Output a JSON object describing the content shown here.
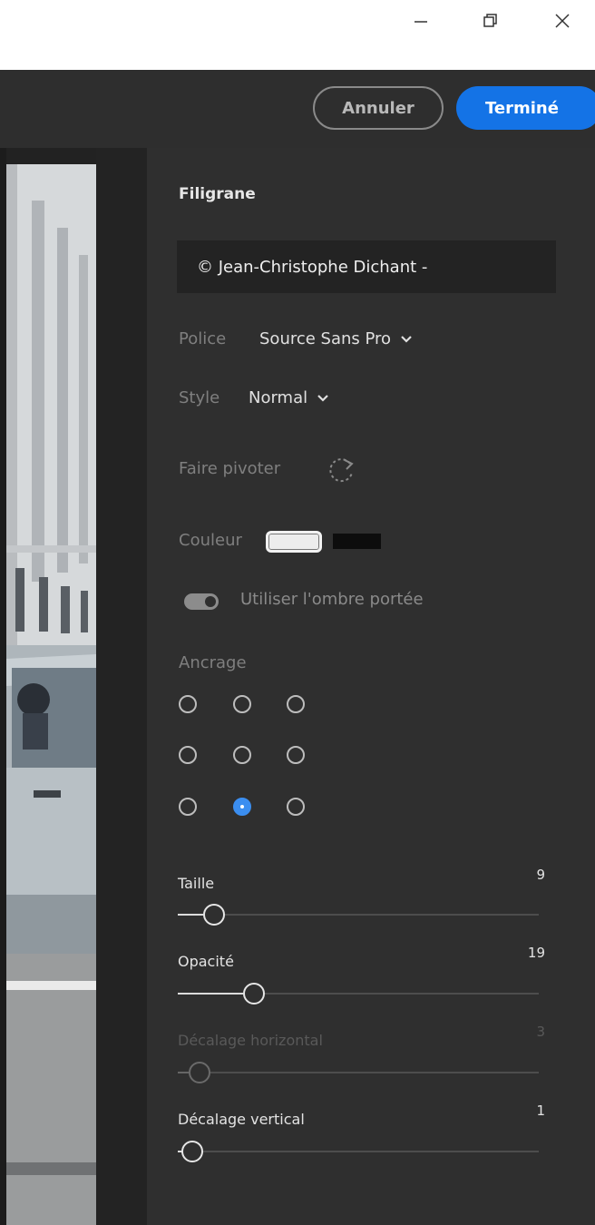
{
  "window": {
    "controls": [
      {
        "name": "minimize",
        "icon": "minimize-icon"
      },
      {
        "name": "restore",
        "icon": "restore-icon"
      },
      {
        "name": "close",
        "icon": "close-icon"
      }
    ]
  },
  "toolbar": {
    "cancel_label": "Annuler",
    "done_label": "Terminé"
  },
  "colors": {
    "accent": "#1473e6",
    "panel_bg": "#2f2f2f",
    "watermark_color": "#ffffff",
    "shadow_color": "#000000"
  },
  "panel": {
    "title": "Filigrane",
    "watermark_text": "© Jean-Christophe Dichant -",
    "font": {
      "label": "Police",
      "value": "Source Sans Pro"
    },
    "style": {
      "label": "Style",
      "value": "Normal"
    },
    "rotate": {
      "label": "Faire pivoter",
      "icon": "rotate-icon"
    },
    "color": {
      "label": "Couleur"
    },
    "shadow": {
      "label": "Utiliser l'ombre portée",
      "enabled": true
    },
    "anchor": {
      "label": "Ancrage",
      "selected": "bottom-center"
    },
    "sliders": [
      {
        "label": "Taille",
        "value": "9",
        "fraction": 0.1,
        "disabled": false
      },
      {
        "label": "Opacité",
        "value": "19",
        "fraction": 0.21,
        "disabled": false
      },
      {
        "label": "Décalage horizontal",
        "value": "3",
        "fraction": 0.06,
        "disabled": true
      },
      {
        "label": "Décalage vertical",
        "value": "1",
        "fraction": 0.04,
        "disabled": false
      }
    ]
  }
}
